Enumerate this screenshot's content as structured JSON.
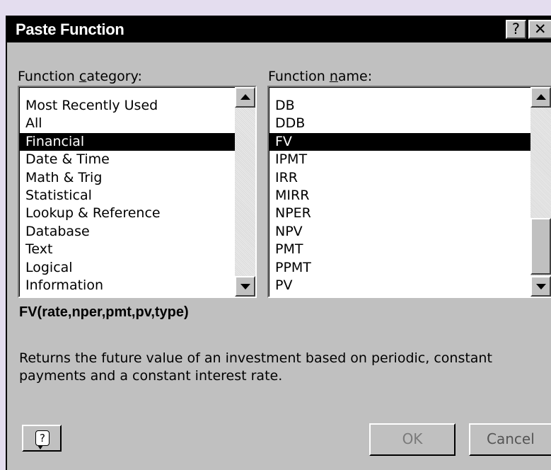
{
  "dialog": {
    "title": "Paste Function",
    "help_glyph": "?",
    "close_glyph": "✕"
  },
  "category": {
    "label_pre": "Function ",
    "label_accel": "c",
    "label_post": "ategory:",
    "items": [
      "Most Recently Used",
      "All",
      "Financial",
      "Date & Time",
      "Math & Trig",
      "Statistical",
      "Lookup & Reference",
      "Database",
      "Text",
      "Logical",
      "Information"
    ],
    "selected": "Financial"
  },
  "function": {
    "label_pre": "Function ",
    "label_accel": "n",
    "label_post": "ame:",
    "items": [
      "DB",
      "DDB",
      "FV",
      "IPMT",
      "IRR",
      "MIRR",
      "NPER",
      "NPV",
      "PMT",
      "PPMT",
      "PV"
    ],
    "selected": "FV"
  },
  "syntax": "FV(rate,nper,pmt,pv,type)",
  "description": "Returns the future value of an investment based on periodic, constant payments and a constant interest rate.",
  "buttons": {
    "ok": "OK",
    "cancel": "Cancel",
    "help_icon": "?"
  },
  "icons": {
    "scroll_up": "up-arrow-icon",
    "scroll_down": "down-arrow-icon",
    "help": "help-balloon-icon"
  }
}
